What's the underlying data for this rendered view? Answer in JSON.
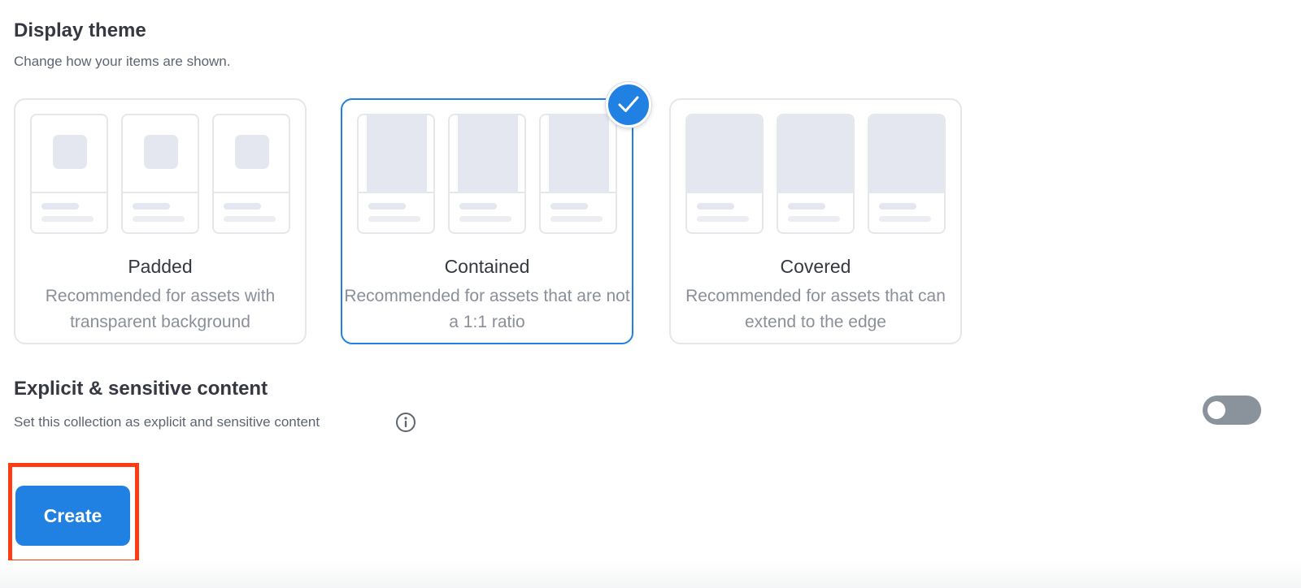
{
  "display_theme": {
    "title": "Display theme",
    "description": "Change how your items are shown.",
    "options": [
      {
        "name": "Padded",
        "description": "Recommended for assets with transparent background",
        "selected": false
      },
      {
        "name": "Contained",
        "description": "Recommended for assets that are not a 1:1 ratio",
        "selected": true
      },
      {
        "name": "Covered",
        "description": "Recommended for assets that can extend to the edge",
        "selected": false
      }
    ]
  },
  "explicit": {
    "title": "Explicit & sensitive content",
    "description": "Set this collection as explicit and sensitive content",
    "toggle_on": false,
    "icon": "info-icon"
  },
  "actions": {
    "create_label": "Create"
  },
  "colors": {
    "accent": "#2081e2",
    "highlight": "#ff3b14",
    "toggle_off": "#8a939b"
  }
}
